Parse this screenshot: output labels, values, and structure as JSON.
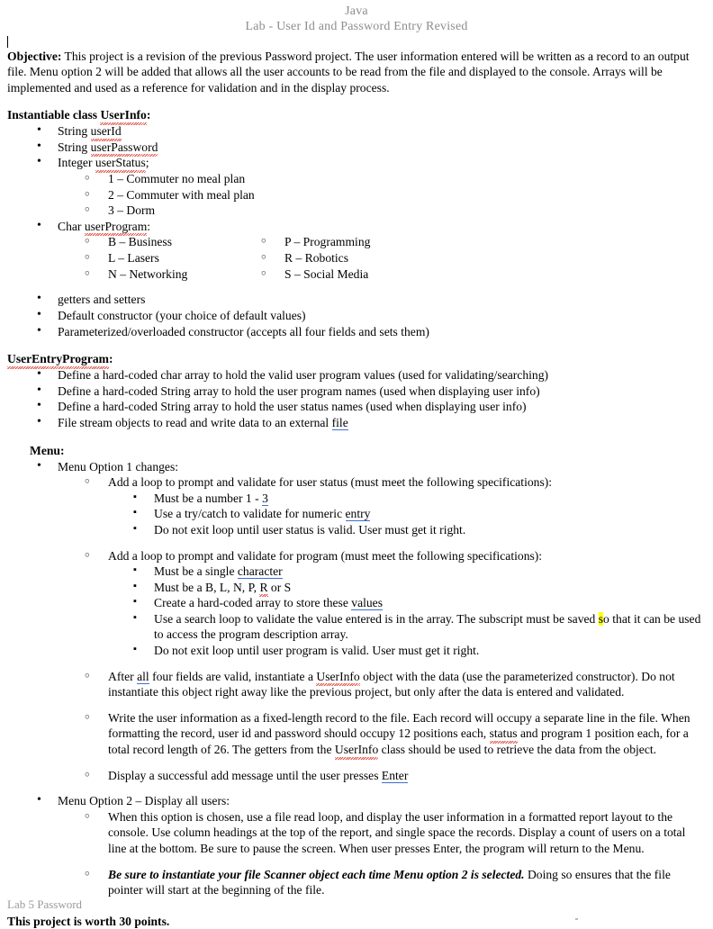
{
  "header": {
    "line1": "Java",
    "line2": "Lab - User Id and Password Entry Revised"
  },
  "objective": {
    "label": "Objective",
    "colon": ":",
    "text": "  This project is a revision of the previous Password project. The user information entered will be written as a record to an output file. Menu option 2 will be added that allows all the user accounts to be read from the file and displayed to the console. Arrays will be implemented and used as a reference for validation and in the display process."
  },
  "userinfo_section": {
    "heading_prefix": "Instantiable class ",
    "heading_class": "UserInfo",
    "heading_suffix": ":",
    "fields": [
      {
        "pre": "String ",
        "name": "userId",
        "post": ""
      },
      {
        "pre": "String ",
        "name": "userPassword",
        "post": ""
      },
      {
        "pre": "Integer ",
        "name": "userStatus",
        "post": ";"
      }
    ],
    "status_values": [
      "1 – Commuter no meal plan",
      "2 – Commuter with meal plan",
      "3 – Dorm"
    ],
    "program_field": {
      "pre": "Char ",
      "name": "userProgram",
      "post": ":"
    },
    "program_values_col1": [
      "B – Business",
      "L – Lasers",
      "N – Networking"
    ],
    "program_values_col2": [
      "P – Programming",
      "R – Robotics",
      "S – Social Media"
    ],
    "misc_items": [
      "getters and setters",
      "Default constructor (your choice of default values)",
      "Parameterized/overloaded constructor (accepts all four fields and sets them)"
    ]
  },
  "entry_program_section": {
    "heading": "UserEntryProgram",
    "heading_suffix": ":",
    "items": [
      "Define a hard-coded char array to hold the valid user program values (used for validating/searching)",
      "Define a hard-coded String array to hold the user program names (used when displaying user info)",
      "Define a hard-coded String array to hold the user status names (used when displaying user info)"
    ],
    "file_item_pre": "File stream objects to read and write data to an external ",
    "file_item_link": "file"
  },
  "menu_section": {
    "heading": "Menu",
    "heading_suffix": ":",
    "option1_label": "Menu Option 1 changes:",
    "status_loop": {
      "intro": "Add a loop to prompt and validate for user status (must meet the following specifications):",
      "spec1_pre": "Must be a number 1 - ",
      "spec1_link": "3",
      "spec2_pre": "Use a try/catch to validate for numeric ",
      "spec2_link": "entry",
      "spec3": "Do not exit loop until user status is valid. User must get it right."
    },
    "program_loop": {
      "intro": "Add a loop to prompt and validate for program (must meet the following specifications):",
      "spec1_pre": "Must be a single ",
      "spec1_link": "character",
      "spec2_pre": "Must be a B, L, N, P, ",
      "spec2_sq": "R",
      "spec2_post": " or S",
      "spec3_pre": "Create a hard-coded array to store these ",
      "spec3_link": "values",
      "spec4_pre": "Use a search loop to validate the value entered is in the array. The subscript must be saved ",
      "spec4_hl": "s",
      "spec4_post": "o that it can be used to access the program description array.",
      "spec5": "Do not exit loop until user program is valid. User must get it right."
    },
    "instantiate": {
      "pre": "After ",
      "link": "all",
      "mid": " four fields are valid, instantiate a ",
      "cls": "UserInfo",
      "post": " object with the data (use the parameterized constructor). Do not instantiate this object right away like the previous project, but only after the data is entered and validated."
    },
    "write_record": {
      "p1": "Write the user information as a fixed-length record to the file. Each record will occupy a separate line in the file. When formatting the record, user id and password should occupy 12 positions each, ",
      "sq1": "status",
      "p2": " and program 1 position each, for a total record length of 26. The getters from the ",
      "sq2": "UserInfo",
      "p3": " class should be used to retrieve the data from the object."
    },
    "success_msg": {
      "pre": "Display a successful add message until the user presses ",
      "link": "Enter"
    },
    "option2_label": "Menu Option 2 – Display all users:",
    "option2_detail": "When this option is chosen, use a file read loop, and display the user information in a formatted report layout to the console. Use column headings at the top of the report, and single space the records. Display a count of users on a total line at the bottom. Be sure to pause the screen. When user presses Enter, the program will return to the Menu.",
    "option2_note_bold": "Be sure to instantiate your file Scanner object each time Menu option 2 is selected.",
    "option2_note_rest": " Doing so ensures that the file pointer will start at the beginning of the file."
  },
  "worth": "This project is worth 30 points.",
  "footer": "Lab 5 Password"
}
